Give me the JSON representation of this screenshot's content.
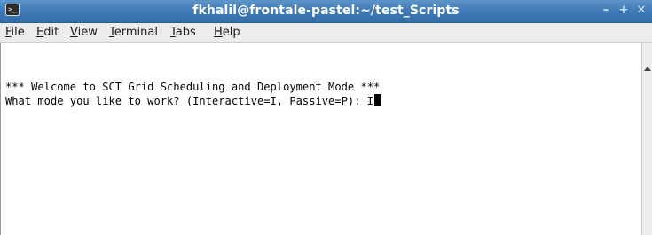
{
  "window": {
    "title": "fkhalil@frontale-pastel:~/test_Scripts",
    "controls": {
      "minimize": "–",
      "maximize": "+",
      "close": "✕"
    },
    "icon": "terminal-icon",
    "icon_glyph": ">_"
  },
  "menubar": {
    "items": [
      {
        "mnemonic": "F",
        "rest": "ile"
      },
      {
        "mnemonic": "E",
        "rest": "dit"
      },
      {
        "mnemonic": "V",
        "rest": "iew"
      },
      {
        "mnemonic": "T",
        "rest": "erminal"
      },
      {
        "mnemonic": "T",
        "rest": "abs"
      },
      {
        "mnemonic": "H",
        "rest": "elp"
      }
    ]
  },
  "terminal": {
    "lines": [
      "*** Welcome to SCT Grid Scheduling and Deployment Mode ***",
      "What mode you like to work? (Interactive=I, Passive=P): I"
    ]
  },
  "colors": {
    "titlebar": "#3f7ab6",
    "menubar": "#edeceb",
    "terminal_bg": "#ffffff",
    "terminal_fg": "#000000"
  }
}
